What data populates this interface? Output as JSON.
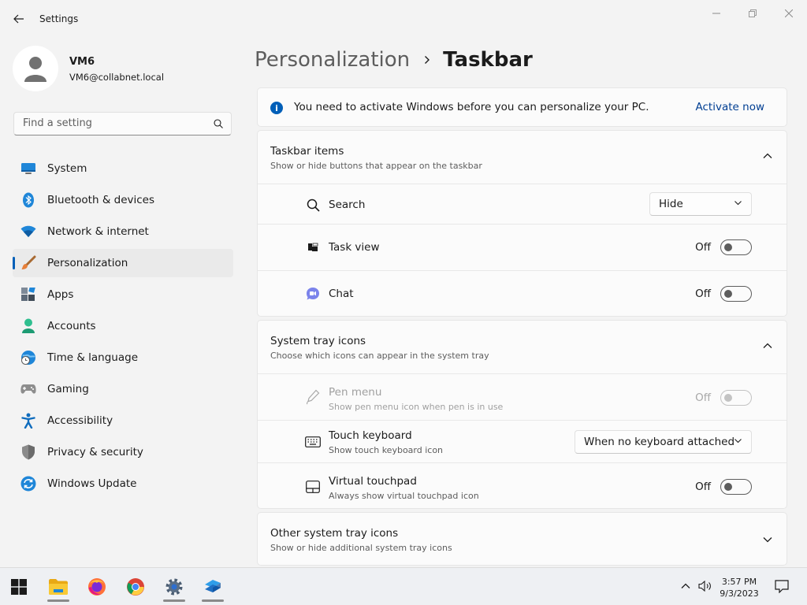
{
  "window": {
    "title": "Settings"
  },
  "user": {
    "name": "VM6",
    "email": "VM6@collabnet.local"
  },
  "search": {
    "placeholder": "Find a setting"
  },
  "nav": {
    "items": [
      {
        "label": "System"
      },
      {
        "label": "Bluetooth & devices"
      },
      {
        "label": "Network & internet"
      },
      {
        "label": "Personalization"
      },
      {
        "label": "Apps"
      },
      {
        "label": "Accounts"
      },
      {
        "label": "Time & language"
      },
      {
        "label": "Gaming"
      },
      {
        "label": "Accessibility"
      },
      {
        "label": "Privacy & security"
      },
      {
        "label": "Windows Update"
      }
    ],
    "active": "Personalization"
  },
  "breadcrumb": {
    "parent": "Personalization",
    "current": "Taskbar"
  },
  "banner": {
    "text": "You need to activate Windows before you can personalize your PC.",
    "link": "Activate now"
  },
  "taskbar_items": {
    "title": "Taskbar items",
    "subtitle": "Show or hide buttons that appear on the taskbar",
    "rows": [
      {
        "label": "Search",
        "value": "Hide"
      },
      {
        "label": "Task view",
        "state": "Off"
      },
      {
        "label": "Chat",
        "state": "Off"
      }
    ]
  },
  "system_tray": {
    "title": "System tray icons",
    "subtitle": "Choose which icons can appear in the system tray",
    "rows": [
      {
        "label": "Pen menu",
        "sub": "Show pen menu icon when pen is in use",
        "state": "Off",
        "disabled": true
      },
      {
        "label": "Touch keyboard",
        "sub": "Show touch keyboard icon",
        "value": "When no keyboard attached"
      },
      {
        "label": "Virtual touchpad",
        "sub": "Always show virtual touchpad icon",
        "state": "Off"
      }
    ]
  },
  "other_tray": {
    "title": "Other system tray icons",
    "subtitle": "Show or hide additional system tray icons"
  },
  "taskbar": {
    "time": "3:57 PM",
    "date": "9/3/2023"
  },
  "colors": {
    "accent": "#005fb8",
    "link": "#003e92",
    "background": "#f3f3f3",
    "card": "#fbfbfb"
  }
}
